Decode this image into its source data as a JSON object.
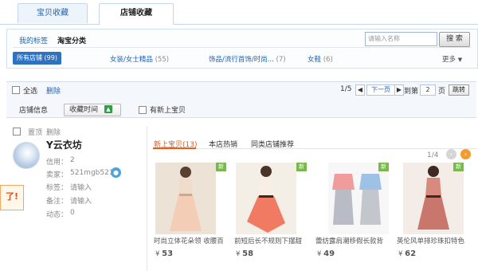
{
  "tabs": [
    {
      "label": "宝贝收藏",
      "active": false
    },
    {
      "label": "店铺收藏",
      "active": true
    }
  ],
  "tag_panel": {
    "my_tags": "我的标签",
    "taobao_category": "淘宝分类",
    "search_placeholder": "请输入名称",
    "search_button": "搜 索",
    "all_shops": "所有店铺 (99)",
    "categories": [
      {
        "name": "女装/女士精品",
        "count": "(55)"
      },
      {
        "name": "饰品/流行首饰/时尚...",
        "count": "(7)"
      },
      {
        "name": "女鞋",
        "count": "(6)"
      }
    ],
    "more": "更多"
  },
  "toolbar": {
    "select_all": "全选",
    "delete": "删除",
    "page_info": "1/5",
    "next_page": "下一页",
    "goto": "到第",
    "page_input": "2",
    "page_unit": "页",
    "jump": "跳转"
  },
  "sort_row": {
    "shop_info": "店铺信息",
    "collect_time": "收藏时间",
    "has_new": "有新上宝贝"
  },
  "shop": {
    "pin": "置顶",
    "delete": "删除",
    "name": "Y云衣坊",
    "credit_label": "信用：",
    "credit_value": "2",
    "seller_label": "卖家：",
    "seller_value": "521mgb521",
    "tag_label": "标签：",
    "tag_value": "请输入",
    "note_label": "备注：",
    "note_value": "请输入",
    "activity_label": "动态：",
    "activity_value": "0",
    "promo_text": "了!"
  },
  "product_tabs": {
    "new": "新上宝贝(13)",
    "hot": "本店热销",
    "similar": "同类店铺推荐",
    "pager": "1/4"
  },
  "products": [
    {
      "name": "时尚立体花朵领 收腰百",
      "currency": "¥",
      "price": "53",
      "new_tag": "新"
    },
    {
      "name": "前短后长不规则下摆甜",
      "currency": "¥",
      "price": "58",
      "new_tag": "新"
    },
    {
      "name": "蕾纺露肩潮移假长款背",
      "currency": "¥",
      "price": "49",
      "new_tag": "新"
    },
    {
      "name": "英伦风单排珍珠扣特色",
      "currency": "¥",
      "price": "62",
      "new_tag": "新"
    }
  ],
  "colors": {
    "link_blue": "#2162b3",
    "accent_orange": "#e85b1b",
    "new_green": "#79b84d"
  }
}
